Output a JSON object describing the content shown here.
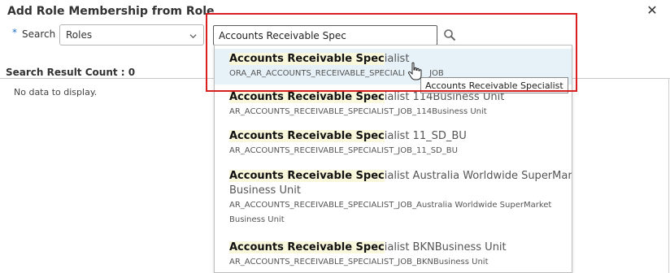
{
  "dialog": {
    "title": "Add Role Membership from Role",
    "close_label": "✕"
  },
  "search": {
    "required_marker": "*",
    "label": "Search",
    "category_value": "Roles",
    "query": "Accounts Receivable Spec"
  },
  "results": {
    "count_label": "Search Result Count : 0",
    "empty_text": "No data to display."
  },
  "suggestions": [
    {
      "match": "Accounts Receivable Spec",
      "rest": "ialist",
      "code": "ORA_AR_ACCOUNTS_RECEIVABLE_SPECIALIST_JOB",
      "code_visible": "ORA_AR_ACCOUNTS_RECEIVABLE_SPECIALI",
      "code_tail": "JOB"
    },
    {
      "match": "Accounts Receivable Spec",
      "rest": "ialist 114Business Unit",
      "code": "AR_ACCOUNTS_RECEIVABLE_SPECIALIST_JOB_114Business Unit"
    },
    {
      "match": "Accounts Receivable Spec",
      "rest": "ialist 11_SD_BU",
      "code": "AR_ACCOUNTS_RECEIVABLE_SPECIALIST_JOB_11_SD_BU"
    },
    {
      "match": "Accounts Receivable Spec",
      "rest": "ialist Australia Worldwide SuperMarket",
      "rest2": "Business Unit",
      "code": "AR_ACCOUNTS_RECEIVABLE_SPECIALIST_JOB_Australia Worldwide SuperMarket",
      "code2": "Business Unit"
    },
    {
      "match": "Accounts Receivable Spec",
      "rest": "ialist BKNBusiness Unit",
      "code": "AR_ACCOUNTS_RECEIVABLE_SPECIALIST_JOB_BKNBusiness Unit"
    }
  ],
  "tooltip": "Accounts Receivable Specialist",
  "colors": {
    "highlight_box": "#d92020",
    "selected_row": "#e6f1f8",
    "match_bg": "#f9f7dc",
    "required": "#1b6ec2"
  },
  "icons": {
    "close": "close-icon",
    "dropdown": "chevron-down-icon",
    "search": "search-icon",
    "pointer": "hand-cursor-icon"
  }
}
